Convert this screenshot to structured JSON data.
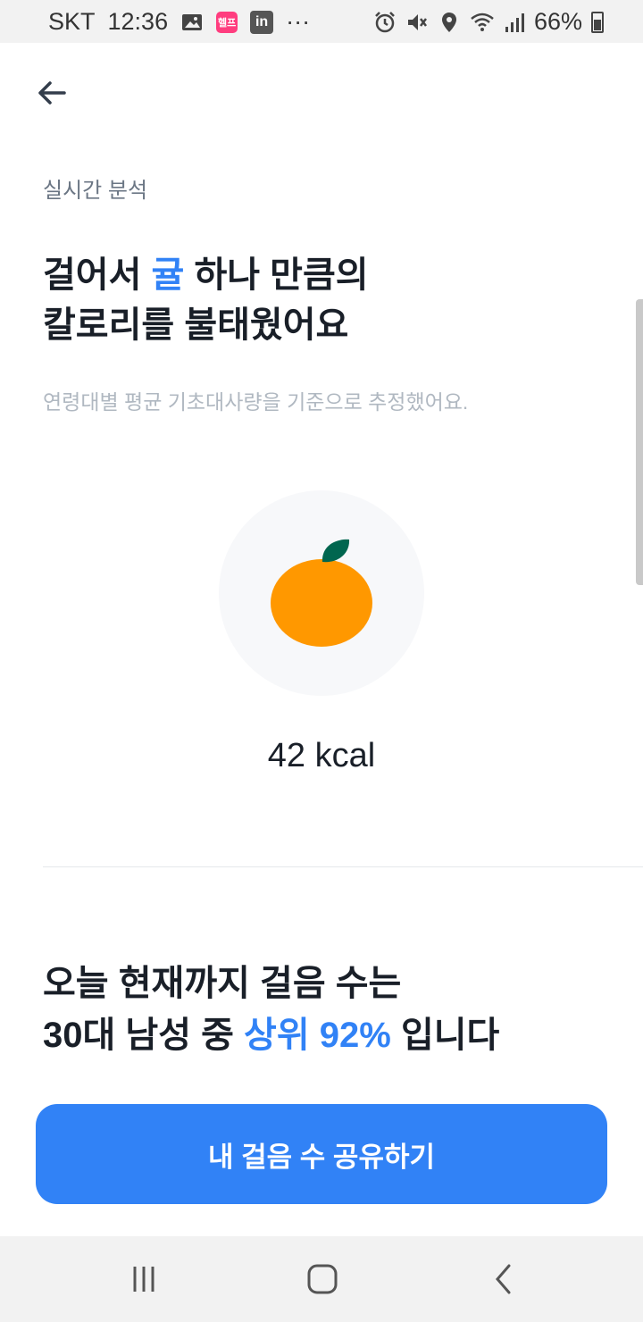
{
  "status_bar": {
    "carrier": "SKT",
    "time": "12:36",
    "app_badge": "헬프",
    "linkedin": "in",
    "more": "···",
    "battery": "66%"
  },
  "header": {
    "back_icon": "arrow-left-icon"
  },
  "section": {
    "label": "실시간 분석"
  },
  "headline": {
    "line1_before": "걸어서 ",
    "line1_accent": "귤",
    "line1_after": " 하나 만큼의",
    "line2": "칼로리를 불태웠어요"
  },
  "subtext": "연령대별 평균 기초대사량을 기준으로 추정했어요.",
  "calorie": {
    "icon": "tangerine-icon",
    "value": "42 kcal"
  },
  "ranking": {
    "line1": "오늘 현재까지 걸음 수는",
    "line2_before": "30대 남성 중 ",
    "line2_accent": "상위 92%",
    "line2_after": " 입니다"
  },
  "share_button": {
    "label": "내 걸음 수 공유하기"
  },
  "colors": {
    "accent": "#3182f6",
    "fruit": "#ff9800",
    "leaf": "#00664f"
  },
  "nav": {
    "recent": "recent-apps-icon",
    "home": "home-icon",
    "back": "back-icon"
  }
}
